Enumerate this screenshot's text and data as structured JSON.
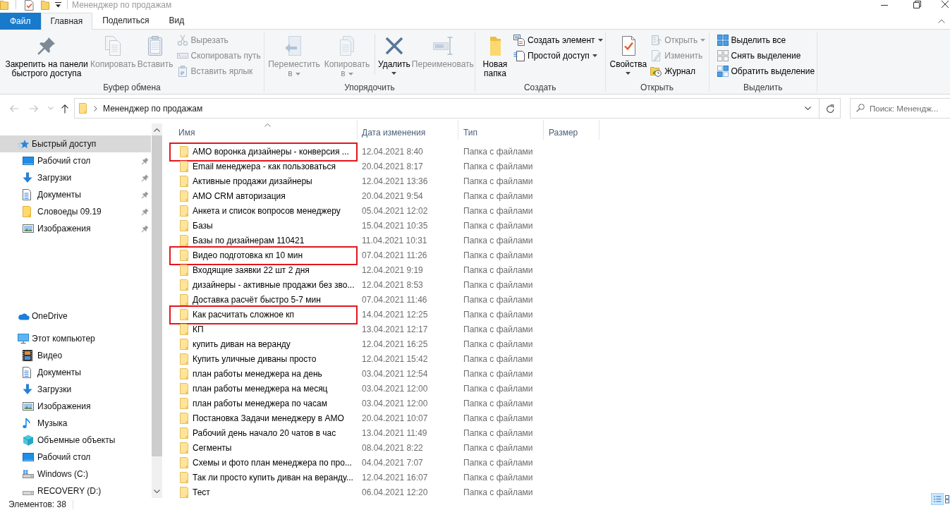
{
  "window": {
    "title": "Мененджер по продажам"
  },
  "ribbon_tabs": [
    {
      "label": "Файл",
      "kind": "file",
      "selected": false
    },
    {
      "label": "Главная",
      "kind": "tab",
      "selected": true
    },
    {
      "label": "Поделиться",
      "kind": "tab",
      "selected": false
    },
    {
      "label": "Вид",
      "kind": "tab",
      "selected": false
    }
  ],
  "ribbon_groups": [
    {
      "label": "Буфер обмена",
      "items": [
        {
          "kind": "large",
          "label": "Закрепить на панели быстрого доступа",
          "disabled": false,
          "dropdown": false
        },
        {
          "kind": "large",
          "label": "Копировать",
          "disabled": true,
          "dropdown": false
        },
        {
          "kind": "large",
          "label": "Вставить",
          "disabled": true,
          "dropdown": false
        },
        {
          "kind": "stack",
          "items": [
            {
              "label": "Вырезать",
              "disabled": true,
              "dropdown": false
            },
            {
              "label": "Скопировать путь",
              "disabled": true,
              "dropdown": false
            },
            {
              "label": "Вставить ярлык",
              "disabled": true,
              "dropdown": false
            }
          ]
        }
      ]
    },
    {
      "label": "Упорядочить",
      "items": [
        {
          "kind": "large",
          "label": "Переместить в",
          "disabled": true,
          "dropdown": true
        },
        {
          "kind": "large",
          "label": "Копировать в",
          "disabled": true,
          "dropdown": true
        },
        {
          "kind": "separator"
        },
        {
          "kind": "large",
          "label": "Удалить",
          "disabled": false,
          "dropdown": true
        },
        {
          "kind": "large",
          "label": "Переименовать",
          "disabled": true,
          "dropdown": false
        }
      ]
    },
    {
      "label": "Создать",
      "items": [
        {
          "kind": "large",
          "label": "Новая папка",
          "disabled": false,
          "dropdown": false
        },
        {
          "kind": "stack",
          "items": [
            {
              "label": "Создать элемент",
              "disabled": false,
              "dropdown": true
            },
            {
              "label": "Простой доступ",
              "disabled": false,
              "dropdown": true
            }
          ]
        }
      ]
    },
    {
      "label": "Открыть",
      "items": [
        {
          "kind": "large",
          "label": "Свойства",
          "disabled": false,
          "dropdown": true
        },
        {
          "kind": "stack",
          "items": [
            {
              "label": "Открыть",
              "disabled": true,
              "dropdown": true
            },
            {
              "label": "Изменить",
              "disabled": true,
              "dropdown": false
            },
            {
              "label": "Журнал",
              "disabled": false,
              "dropdown": false
            }
          ]
        }
      ]
    },
    {
      "label": "Выделить",
      "items": [
        {
          "kind": "stack",
          "items": [
            {
              "label": "Выделить все",
              "disabled": false,
              "dropdown": false
            },
            {
              "label": "Снять выделение",
              "disabled": false,
              "dropdown": false
            },
            {
              "label": "Обратить выделение",
              "disabled": false,
              "dropdown": false
            }
          ]
        }
      ]
    }
  ],
  "navigation_buttons": [
    {
      "disabled": true
    },
    {
      "disabled": true
    },
    {
      "disabled": true
    },
    {
      "disabled": false
    }
  ],
  "address_bar": {
    "path": [
      "Мененджер по продажам"
    ]
  },
  "search": {
    "placeholder": "Поиск: Менендж..."
  },
  "navigation_pane": {
    "items": [
      {
        "label": "Быстрый доступ",
        "selected": true,
        "children": [
          {
            "label": "Рабочий стол",
            "pinned": true,
            "selected": false
          },
          {
            "label": "Загрузки",
            "pinned": true,
            "selected": false
          },
          {
            "label": "Документы",
            "pinned": true,
            "selected": false
          },
          {
            "label": "Словоеды 09.19",
            "pinned": true,
            "selected": false
          },
          {
            "label": "Изображения",
            "pinned": true,
            "selected": false
          }
        ]
      },
      {
        "label": "OneDrive",
        "selected": false
      },
      {
        "label": "Этот компьютер",
        "selected": false,
        "children": [
          {
            "label": "Видео",
            "selected": false
          },
          {
            "label": "Документы",
            "selected": false
          },
          {
            "label": "Загрузки",
            "selected": false
          },
          {
            "label": "Изображения",
            "selected": false
          },
          {
            "label": "Музыка",
            "selected": false
          },
          {
            "label": "Объемные объекты",
            "selected": false
          },
          {
            "label": "Рабочий стол",
            "selected": false
          },
          {
            "label": "Windows (C:)",
            "selected": false
          },
          {
            "label": "RECOVERY (D:)",
            "selected": false
          }
        ]
      }
    ]
  },
  "file_list": {
    "columns": [
      {
        "label": "Имя",
        "sorted": true
      },
      {
        "label": "Дата изменения",
        "sorted": false
      },
      {
        "label": "Тип",
        "sorted": false
      },
      {
        "label": "Размер",
        "sorted": false
      }
    ],
    "rows": [
      {
        "name": "АМО воронка дизайнеры - конверсия ...",
        "modified": "12.04.2021 8:40",
        "type": "Папка с файлами",
        "marked": true,
        "selected": false
      },
      {
        "name": "Email менеджера - как пользоваться",
        "modified": "20.04.2021 8:17",
        "type": "Папка с файлами",
        "marked": false,
        "selected": false
      },
      {
        "name": "Активные продажи дизайнеры",
        "modified": "12.04.2021 13:36",
        "type": "Папка с файлами",
        "marked": false,
        "selected": false
      },
      {
        "name": "АМО CRM авторизация",
        "modified": "20.04.2021 9:54",
        "type": "Папка с файлами",
        "marked": false,
        "selected": false
      },
      {
        "name": "Анкета и список вопросов менеджеру",
        "modified": "05.04.2021 12:02",
        "type": "Папка с файлами",
        "marked": false,
        "selected": false
      },
      {
        "name": "Базы",
        "modified": "15.04.2021 10:35",
        "type": "Папка с файлами",
        "marked": false,
        "selected": false
      },
      {
        "name": "Базы по дизайнерам 110421",
        "modified": "11.04.2021 10:31",
        "type": "Папка с файлами",
        "marked": false,
        "selected": false
      },
      {
        "name": "Видео подготовка кп 10 мин",
        "modified": "07.04.2021 11:26",
        "type": "Папка с файлами",
        "marked": true,
        "selected": false
      },
      {
        "name": "Входящие заявки 22 шт 2 дня",
        "modified": "12.04.2021 9:19",
        "type": "Папка с файлами",
        "marked": false,
        "selected": false
      },
      {
        "name": "дизайнеры - активные продажи без зво...",
        "modified": "12.04.2021 8:53",
        "type": "Папка с файлами",
        "marked": false,
        "selected": false
      },
      {
        "name": "Доставка расчёт быстро 5-7 мин",
        "modified": "07.04.2021 11:46",
        "type": "Папка с файлами",
        "marked": false,
        "selected": false
      },
      {
        "name": "Как расчитать сложное кп",
        "modified": "14.04.2021 12:25",
        "type": "Папка с файлами",
        "marked": true,
        "selected": false
      },
      {
        "name": "КП",
        "modified": "13.04.2021 12:17",
        "type": "Папка с файлами",
        "marked": false,
        "selected": false
      },
      {
        "name": "купить диван на веранду",
        "modified": "12.04.2021 16:25",
        "type": "Папка с файлами",
        "marked": false,
        "selected": false
      },
      {
        "name": "Купить уличные диваны просто",
        "modified": "12.04.2021 15:42",
        "type": "Папка с файлами",
        "marked": false,
        "selected": false
      },
      {
        "name": "план работы менеджера на день",
        "modified": "03.04.2021 12:54",
        "type": "Папка с файлами",
        "marked": false,
        "selected": false
      },
      {
        "name": "план работы менеджера на месяц",
        "modified": "03.04.2021 12:00",
        "type": "Папка с файлами",
        "marked": false,
        "selected": false
      },
      {
        "name": "план работы менеджера по часам",
        "modified": "03.04.2021 12:00",
        "type": "Папка с файлами",
        "marked": false,
        "selected": false
      },
      {
        "name": "Постановка Задачи менеджеру в АМО",
        "modified": "20.04.2021 10:07",
        "type": "Папка с файлами",
        "marked": false,
        "selected": false
      },
      {
        "name": "Рабочий день начало 20 чатов в час",
        "modified": "13.04.2021 11:49",
        "type": "Папка с файлами",
        "marked": false,
        "selected": false
      },
      {
        "name": "Сегменты",
        "modified": "08.04.2021 8:22",
        "type": "Папка с файлами",
        "marked": false,
        "selected": false
      },
      {
        "name": "Схемы и фото план менеджера по про...",
        "modified": "04.04.2021 7:07",
        "type": "Папка с файлами",
        "marked": false,
        "selected": false
      },
      {
        "name": "Так ли просто купить диван на веранду...",
        "modified": "12.04.2021 16:07",
        "type": "Папка с файлами",
        "marked": false,
        "selected": false
      },
      {
        "name": "Тест",
        "modified": "06.04.2021 12:20",
        "type": "Папка с файлами",
        "marked": false,
        "selected": false
      }
    ]
  },
  "status_bar": {
    "item_count": "Элементов: 38",
    "view_buttons": [
      {
        "selected": true
      },
      {
        "selected": false
      }
    ]
  }
}
